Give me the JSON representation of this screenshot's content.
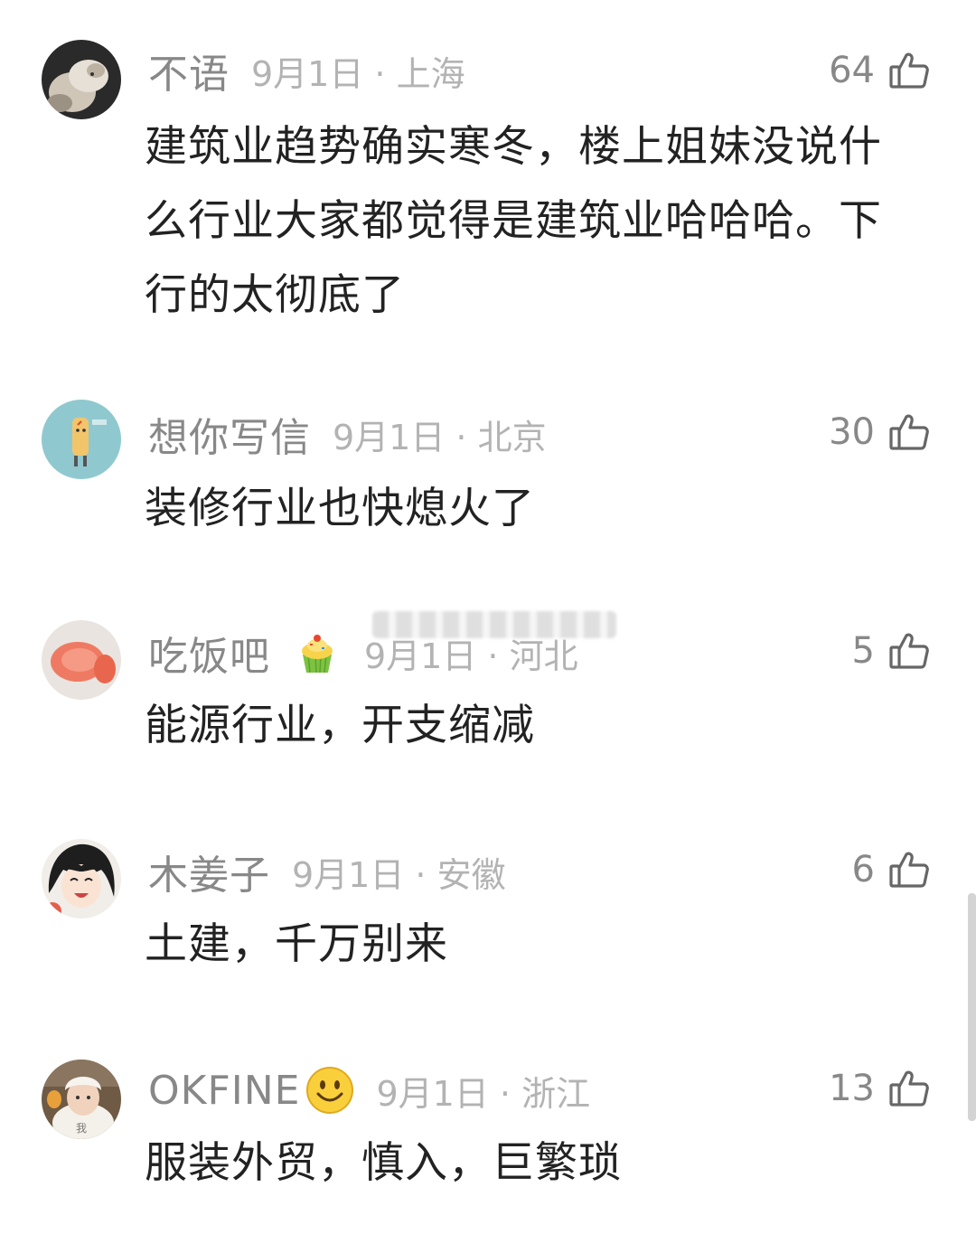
{
  "comments": [
    {
      "username": "不语",
      "date_location": "9月1日 · 上海",
      "likes": "64",
      "content": "建筑业趋势确实寒冬，楼上姐妹没说什么行业大家都觉得是建筑业哈哈哈。下行的太彻底了",
      "avatar_icon": "cat-photo-avatar"
    },
    {
      "username": "想你写信",
      "date_location": "9月1日 · 北京",
      "likes": "30",
      "content": "装修行业也快熄火了",
      "avatar_icon": "cartoon-character-avatar"
    },
    {
      "username": "吃饭吧",
      "date_location": "9月1日 · 河北",
      "likes": "5",
      "content": "能源行业，开支缩减",
      "avatar_icon": "fruit-slice-avatar",
      "badge_icon": "cupcake-emoji"
    },
    {
      "username": "木姜子",
      "date_location": "9月1日 · 安徽",
      "likes": "6",
      "content": "土建，千万别来",
      "avatar_icon": "anime-girl-avatar"
    },
    {
      "username": "OKFINE",
      "date_location": "9月1日 · 浙江",
      "likes": "13",
      "content": "服装外贸，慎入，巨繁琐",
      "avatar_icon": "child-photo-avatar",
      "badge_icon": "smiley-emoji",
      "avatar_text": "我"
    }
  ],
  "colors": {
    "username": "#888888",
    "meta": "#b3b3b3",
    "content": "#222222"
  }
}
